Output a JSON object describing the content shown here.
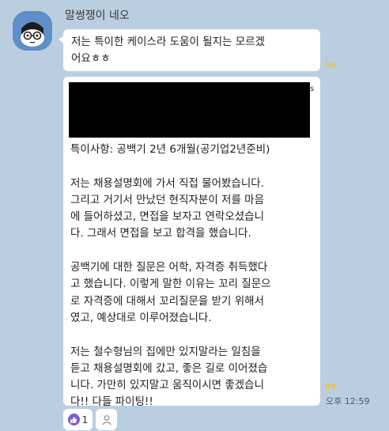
{
  "sender": {
    "name": "말썽쟁이 네오"
  },
  "messages": [
    {
      "text": "저는 특이한 케이스라 도움이 될지는 모르겠\n어요ㅎㅎ",
      "unread": "99"
    },
    {
      "redacted_tail": "s",
      "text": "특이사항: 공백기 2년 6개월(공기업2년준비)\n\n저는 채용설명회에 가서 직접 물어봤습니다.\n그리고 거기서 만났던 현직자분이 저를 마음\n에 들어하셨고, 면접을 보자고 연락오셨습니\n다. 그래서 면접을 보고 합격을 했습니다.\n\n공백기에 대한 질문은 어학, 자격증 취득했다\n고 했습니다. 이렇게 말한 이유는 꼬리 질문으\n로 자격증에 대해서 꼬리질문을 받기 위해서\n였고, 예상대로 이루어졌습니다.\n\n저는 철수형님의 집에만 있지말라는 일침을\n듣고 채용설명회에 갔고, 좋은 길로 이어졌습\n니다. 가만히 있지말고 움직이시면 좋겠습니\n다!! 다들 파이팅!!",
      "unread": "99",
      "time": "오후 12:59"
    }
  ],
  "reactions": {
    "like_count": "1",
    "like_icon": "thumbs-up-icon",
    "add_icon": "person-icon"
  },
  "colors": {
    "background": "#bacee0",
    "bubble": "#ffffff",
    "unread": "#e6c445",
    "like": "#7a5bd1"
  }
}
